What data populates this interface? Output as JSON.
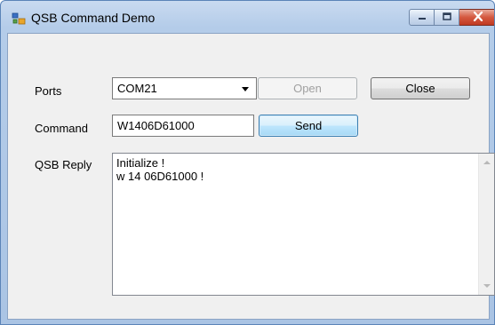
{
  "window": {
    "title": "QSB Command Demo",
    "icons": {
      "app": "app-icon",
      "minimize": "minimize-icon",
      "maximize": "maximize-icon",
      "close": "close-icon"
    }
  },
  "form": {
    "ports_label": "Ports",
    "ports_value": "COM21",
    "open_label": "Open",
    "close_label": "Close",
    "command_label": "Command",
    "command_value": "W1406D61000",
    "send_label": "Send",
    "reply_label": "QSB Reply",
    "reply_text": "Initialize !\nw 14 06D61000 !"
  },
  "colors": {
    "titlebar": "#b4cce9",
    "client_bg": "#f0f0f0",
    "close_button": "#c84a32",
    "send_border": "#3c7fb1"
  }
}
